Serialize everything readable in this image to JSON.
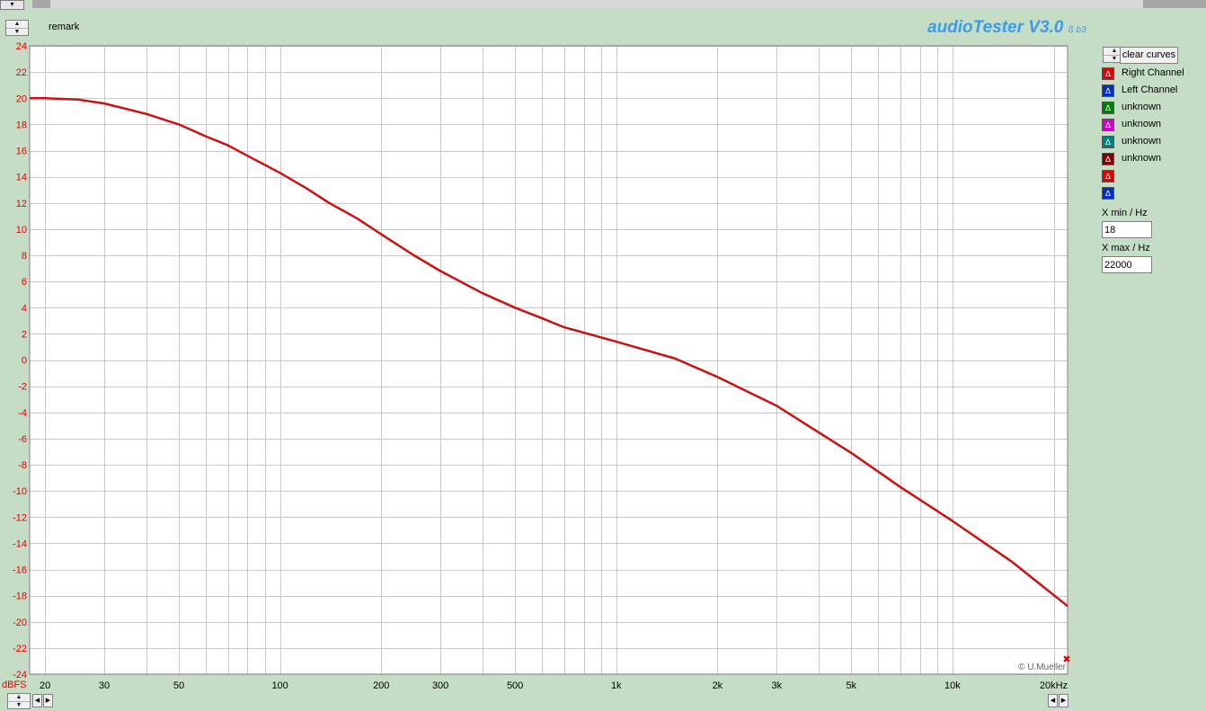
{
  "app": {
    "brand": "audioTester V3.0",
    "brand_suffix": "ß b3",
    "remark": "remark",
    "copyright": "© U.Mueller"
  },
  "legend": {
    "clear_label": "clear curves",
    "items": [
      {
        "label": "Right Channel",
        "color": "#e00000"
      },
      {
        "label": "Left Channel",
        "color": "#0030c0"
      },
      {
        "label": "unknown",
        "color": "#008000"
      },
      {
        "label": "unknown",
        "color": "#d000d0"
      },
      {
        "label": "unknown",
        "color": "#008080"
      },
      {
        "label": "unknown",
        "color": "#800000"
      },
      {
        "label": "",
        "color": "#e00000"
      },
      {
        "label": "",
        "color": "#0030c0"
      }
    ]
  },
  "controls": {
    "xmin_label": "X min / Hz",
    "xmin_value": "18",
    "xmax_label": "X max / Hz",
    "xmax_value": "22000"
  },
  "chart_data": {
    "type": "line",
    "title": "",
    "xlabel": "",
    "ylabel": "dBFS",
    "x_scale": "log",
    "xlim": [
      18,
      22000
    ],
    "ylim": [
      -24,
      24
    ],
    "grid": true,
    "y_ticks": [
      24,
      22,
      20,
      18,
      16,
      14,
      12,
      10,
      8,
      6,
      4,
      2,
      0,
      -2,
      -4,
      -6,
      -8,
      -10,
      -12,
      -14,
      -16,
      -18,
      -20,
      -22,
      -24
    ],
    "x_ticks": [
      {
        "value": 20,
        "label": "20"
      },
      {
        "value": 30,
        "label": "30"
      },
      {
        "value": 50,
        "label": "50"
      },
      {
        "value": 100,
        "label": "100"
      },
      {
        "value": 200,
        "label": "200"
      },
      {
        "value": 300,
        "label": "300"
      },
      {
        "value": 500,
        "label": "500"
      },
      {
        "value": 1000,
        "label": "1k"
      },
      {
        "value": 2000,
        "label": "2k"
      },
      {
        "value": 3000,
        "label": "3k"
      },
      {
        "value": 5000,
        "label": "5k"
      },
      {
        "value": 10000,
        "label": "10k"
      },
      {
        "value": 20000,
        "label": "20kHz"
      }
    ],
    "series": [
      {
        "name": "Right Channel",
        "color": "#cc1111",
        "x": [
          18,
          20,
          25,
          30,
          40,
          50,
          60,
          70,
          80,
          100,
          120,
          140,
          170,
          200,
          250,
          300,
          400,
          500,
          600,
          700,
          1000,
          1500,
          2000,
          3000,
          5000,
          7000,
          10000,
          15000,
          22000
        ],
        "y": [
          20.0,
          20.0,
          19.9,
          19.6,
          18.8,
          18.0,
          17.1,
          16.4,
          15.6,
          14.3,
          13.1,
          12.0,
          10.8,
          9.6,
          8.0,
          6.8,
          5.1,
          4.0,
          3.2,
          2.5,
          1.4,
          0.1,
          -1.3,
          -3.5,
          -7.1,
          -9.7,
          -12.3,
          -15.4,
          -18.8
        ]
      }
    ]
  }
}
